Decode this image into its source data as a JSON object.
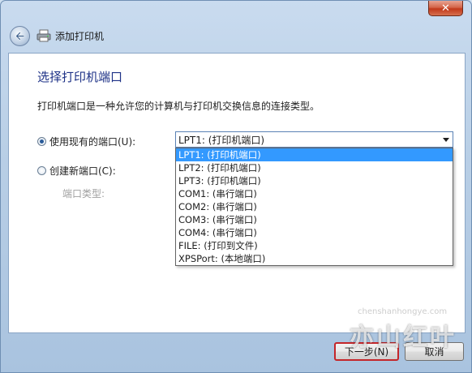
{
  "window": {
    "title": "添加打印机",
    "close_glyph": "✕"
  },
  "page": {
    "heading": "选择打印机端口",
    "description": "打印机端口是一种允许您的计算机与打印机交换信息的连接类型。"
  },
  "options": {
    "use_existing_label": "使用现有的端口(U):",
    "create_new_label": "创建新端口(C):",
    "port_type_label": "端口类型:"
  },
  "port_select": {
    "selected_value": "LPT1: (打印机端口)",
    "items": [
      "LPT1: (打印机端口)",
      "LPT2: (打印机端口)",
      "LPT3: (打印机端口)",
      "COM1: (串行端口)",
      "COM2: (串行端口)",
      "COM3: (串行端口)",
      "COM4: (串行端口)",
      "FILE: (打印到文件)",
      "XPSPort: (本地端口)"
    ]
  },
  "footer": {
    "next_label": "下一步(N)",
    "cancel_label": "取消"
  },
  "watermark": {
    "text": "亦山红叶",
    "url": "chenshanhongye.com"
  },
  "colors": {
    "heading": "#1e3287",
    "selection": "#3399ff",
    "highlight_border": "#c4262a"
  },
  "icons": {
    "back": "back-arrow-icon",
    "printer": "printer-icon",
    "dropdown": "chevron-down-icon"
  }
}
